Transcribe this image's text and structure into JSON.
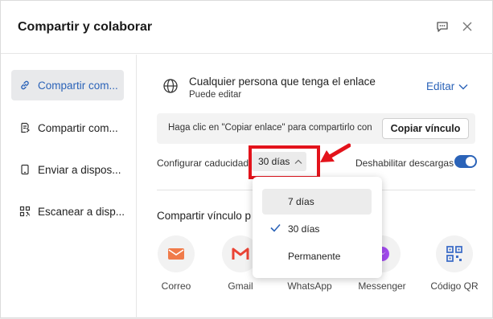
{
  "dialog": {
    "title": "Compartir y colaborar",
    "header_icons": [
      "feedback-icon",
      "close-icon"
    ]
  },
  "sidebar": {
    "items": [
      {
        "label": "Compartir com...",
        "icon": "link-icon",
        "active": true
      },
      {
        "label": "Compartir com...",
        "icon": "share-document-icon",
        "active": false
      },
      {
        "label": "Enviar a dispos...",
        "icon": "device-icon",
        "active": false
      },
      {
        "label": "Escanear a disp...",
        "icon": "qr-scan-icon",
        "active": false
      }
    ]
  },
  "access": {
    "who": "Cualquier persona que tenga el enlace",
    "permission": "Puede editar",
    "edit_label": "Editar"
  },
  "link": {
    "hint": "Haga clic en \"Copiar enlace\" para compartirlo con",
    "copy_button": "Copiar vínculo"
  },
  "expiry": {
    "label": "Configurar caducidad",
    "selected": "30 días",
    "options": [
      "7 días",
      "30 días",
      "Permanente"
    ],
    "highlighted": "7 días",
    "checked": "30 días"
  },
  "downloads": {
    "label": "Deshabilitar descargas",
    "enabled": true
  },
  "share_via": {
    "title": "Compartir vínculo p",
    "services": [
      {
        "label": "Correo",
        "icon": "mail-icon",
        "color": "#f07b4a"
      },
      {
        "label": "Gmail",
        "icon": "gmail-icon",
        "color": "#ea4335"
      },
      {
        "label": "WhatsApp",
        "icon": "whatsapp-icon",
        "color": "#25d366"
      },
      {
        "label": "Messenger",
        "icon": "messenger-icon",
        "color": "#a34bf0"
      },
      {
        "label": "Código QR",
        "icon": "qr-code-icon",
        "color": "#3f6ec7"
      }
    ]
  },
  "colors": {
    "accent": "#2b63b8",
    "annotation_red": "#e3131b"
  }
}
